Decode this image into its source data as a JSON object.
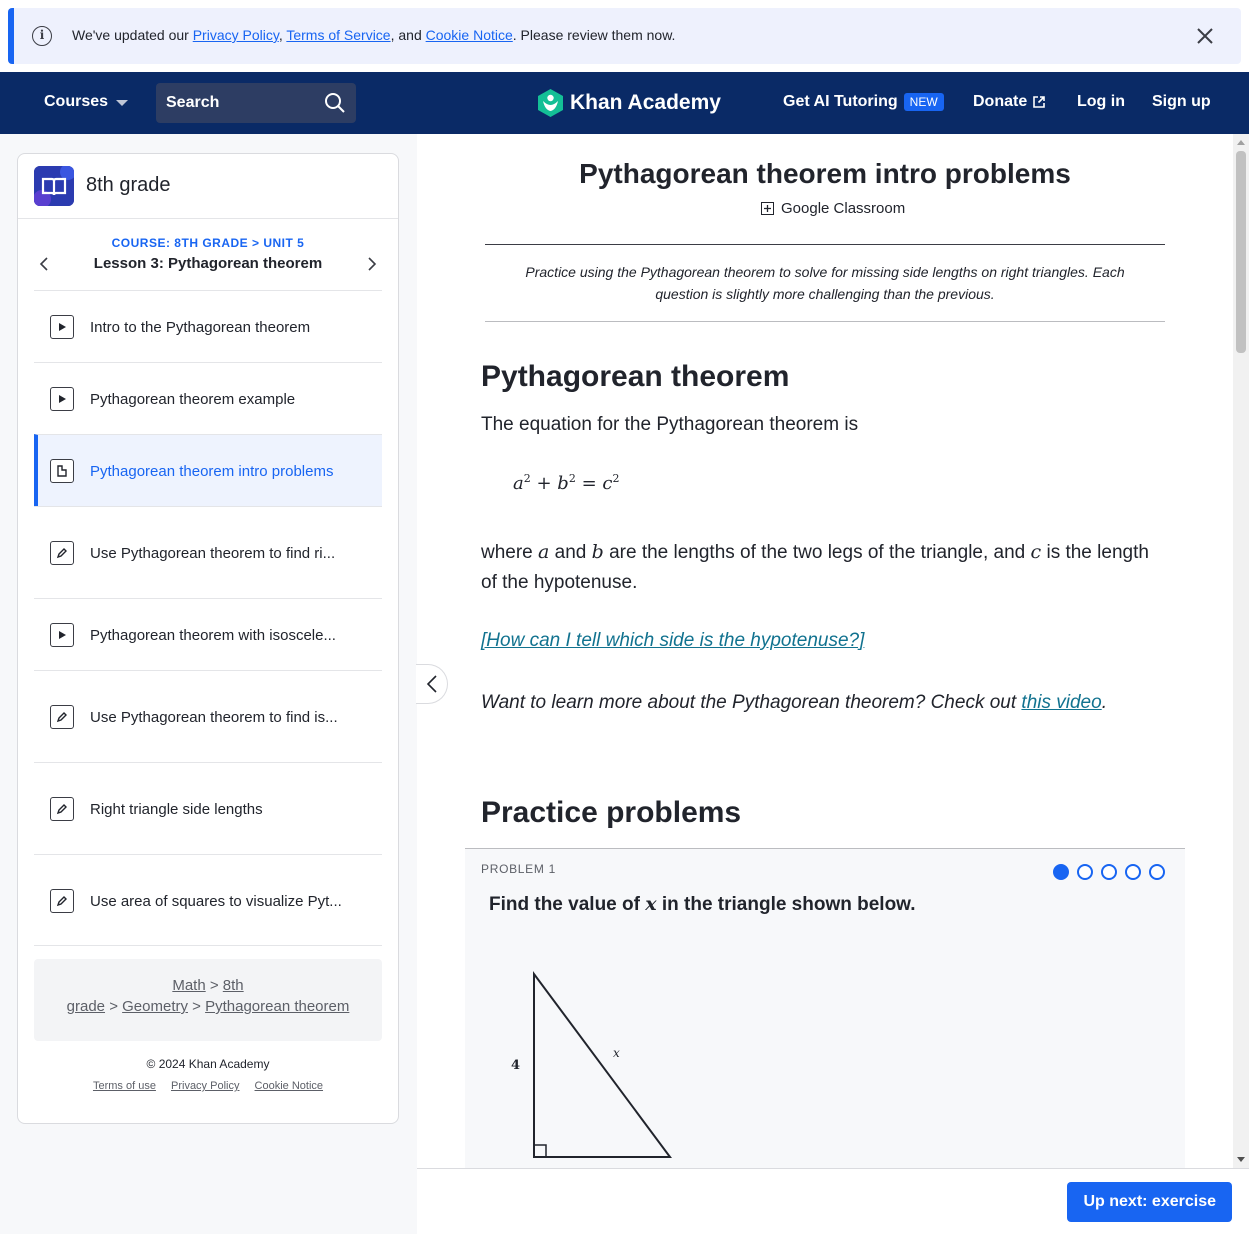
{
  "notice": {
    "prefix": "We've updated our ",
    "privacy_link": "Privacy Policy",
    "comma": ", ",
    "terms_link": "Terms of Service",
    "and": ", and ",
    "cookie_link": "Cookie Notice",
    "suffix": ". Please review them now.",
    "info_icon": "i"
  },
  "nav": {
    "courses": "Courses",
    "search_label": "Search",
    "logo": "Khan Academy",
    "ai_tutoring": "Get AI Tutoring",
    "new_badge": "NEW",
    "donate": "Donate",
    "login": "Log in",
    "signup": "Sign up"
  },
  "sidebar": {
    "course_title": "8th grade",
    "kicker": "COURSE: 8TH GRADE > UNIT 5",
    "lesson": "Lesson 3: Pythagorean theorem",
    "items": [
      {
        "label": "Intro to the Pythagorean theorem",
        "icon": "play-icon"
      },
      {
        "label": "Pythagorean theorem example",
        "icon": "play-icon"
      },
      {
        "label": "Pythagorean theorem intro problems",
        "icon": "article-icon",
        "active": true
      },
      {
        "label": "Use Pythagorean theorem to find ri...",
        "icon": "pencil-icon"
      },
      {
        "label": "Pythagorean theorem with isoscele...",
        "icon": "play-icon"
      },
      {
        "label": "Use Pythagorean theorem to find is...",
        "icon": "pencil-icon"
      },
      {
        "label": "Right triangle side lengths",
        "icon": "pencil-icon"
      },
      {
        "label": "Use area of squares to visualize Pyt...",
        "icon": "pencil-icon"
      }
    ],
    "breadcrumb": {
      "math": "Math",
      "grade_a": "8th",
      "grade_b": "grade",
      "geometry": "Geometry",
      "topic": "Pythagorean theorem",
      "sep": ">"
    },
    "copyright": "© 2024 Khan Academy",
    "legal": {
      "terms": "Terms of use",
      "privacy": "Privacy Policy",
      "cookie": "Cookie Notice"
    }
  },
  "main": {
    "title": "Pythagorean theorem intro problems",
    "google_classroom": "Google Classroom",
    "intro": "Practice using the Pythagorean theorem to solve for missing side lengths on right triangles.  Each question is slightly more challenging than the previous.",
    "section1_heading": "Pythagorean theorem",
    "equation_intro": "The equation for the Pythagorean theorem is",
    "equation": {
      "a": "a",
      "b": "b",
      "c": "c",
      "exp": "2",
      "plus": "+",
      "eq": "="
    },
    "where": {
      "p1": "where ",
      "a": "a",
      "p2": " and ",
      "b": "b",
      "p3": " are the lengths of the two legs of the triangle, and ",
      "c": "c",
      "p4": " is the length of the hypotenuse."
    },
    "hypotenuse_link": "[How can I tell which side is the hypotenuse?]",
    "learn_more": "Want to learn more about the Pythagorean theorem? Check out ",
    "video_link": "this video",
    "period": ".",
    "section2_heading": "Practice problems",
    "problem": {
      "label": "PROBLEM 1",
      "total": 5,
      "current": 1,
      "question_pre": "Find the value of ",
      "question_var": "x",
      "question_post": " in the triangle shown below.",
      "leg_label": "4",
      "hyp_label": "x"
    }
  },
  "footer": {
    "up_next": "Up next: exercise"
  },
  "colors": {
    "brand_blue": "#1865f2",
    "nav_bg": "#0a2a66",
    "link_teal": "#11728f"
  }
}
